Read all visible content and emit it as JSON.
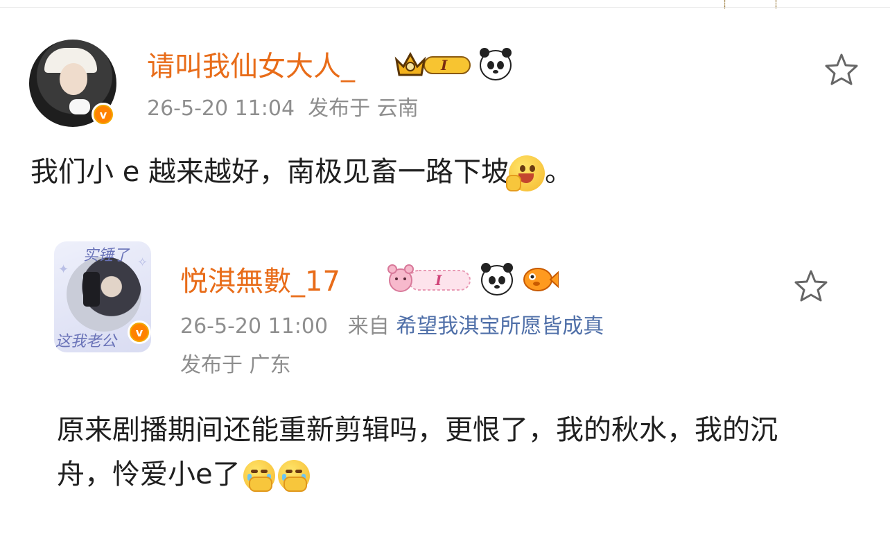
{
  "post": {
    "username": "请叫我仙女大人_",
    "time": "26-5-20 11:04",
    "location": "发布于 云南",
    "text": "我们小 e 越来越好，南极见畜一路下坡",
    "text_end": "。",
    "member_badge_level": "I",
    "icons": [
      "crown-icon",
      "panda-icon",
      "star-icon",
      "verified-v-icon",
      "grin-emoji-icon"
    ]
  },
  "reply": {
    "avatar_caption_top": "实锤了",
    "avatar_caption_bottom": "这我老公",
    "username": "悦淇無數_17",
    "time": "26-5-20 11:00",
    "source_label": "来自",
    "source": "希望我淇宝所愿皆成真",
    "location": "发布于 广东",
    "text": "原来剧播期间还能重新剪辑吗，更恨了，我的秋水，我的沉舟，怜爱小e了",
    "member_badge_level": "I",
    "icons": [
      "pink-bear-badge-icon",
      "panda-icon",
      "goldfish-icon",
      "star-icon",
      "verified-v-icon",
      "crying-emoji-icon"
    ]
  },
  "colors": {
    "username": "#e86c19",
    "meta": "#8e8e8e",
    "link": "#4f6fa8",
    "text": "#1f1f1f",
    "verified": "#ff8200"
  }
}
